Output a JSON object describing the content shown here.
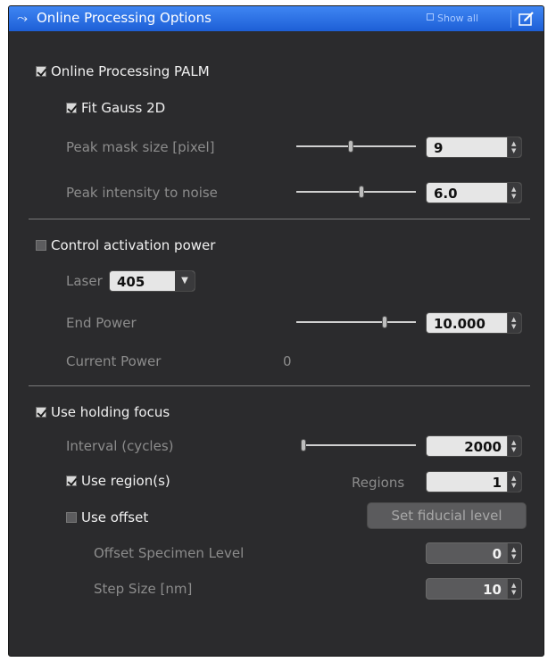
{
  "panel": {
    "title": "Online Processing Options",
    "show_all": "Show all"
  },
  "palm": {
    "checkbox_label": "Online Processing PALM",
    "checked": true,
    "fit_gauss_label": "Fit Gauss 2D",
    "fit_gauss_checked": true,
    "peak_mask_label": "Peak mask size [pixel]",
    "peak_mask_value": "9",
    "peak_mask_slider_fraction": 0.45,
    "peak_intensity_label": "Peak intensity to noise",
    "peak_intensity_value": "6.0",
    "peak_intensity_slider_fraction": 0.55
  },
  "activation": {
    "checkbox_label": "Control activation power",
    "checked": false,
    "laser_label": "Laser",
    "laser_value": "405",
    "end_power_label": "End Power",
    "end_power_value": "10.000",
    "end_power_slider_fraction": 0.75,
    "current_power_label": "Current Power",
    "current_power_value": "0"
  },
  "focus": {
    "checkbox_label": "Use holding focus",
    "checked": true,
    "interval_label": "Interval (cycles)",
    "interval_value": "2000",
    "interval_slider_fraction": 0.0,
    "use_regions_label": "Use region(s)",
    "use_regions_checked": true,
    "regions_label": "Regions",
    "regions_value": "1",
    "use_offset_label": "Use offset",
    "use_offset_checked": false,
    "set_fiducial_button": "Set fiducial level",
    "offset_specimen_label": "Offset Specimen Level",
    "offset_specimen_value": "0",
    "step_size_label": "Step Size [nm]",
    "step_size_value": "10"
  },
  "icons": [
    "expand-arrow-icon",
    "show-all-box-icon",
    "edit-window-icon",
    "checkmark-icon",
    "spin-up-icon",
    "spin-down-icon",
    "dropdown-arrow-icon"
  ],
  "colors": {
    "title_bar": "#2f74ea",
    "panel_bg": "#2b2b2d",
    "text_enabled": "#f1f1f1",
    "text_disabled": "#8c8c8c"
  }
}
